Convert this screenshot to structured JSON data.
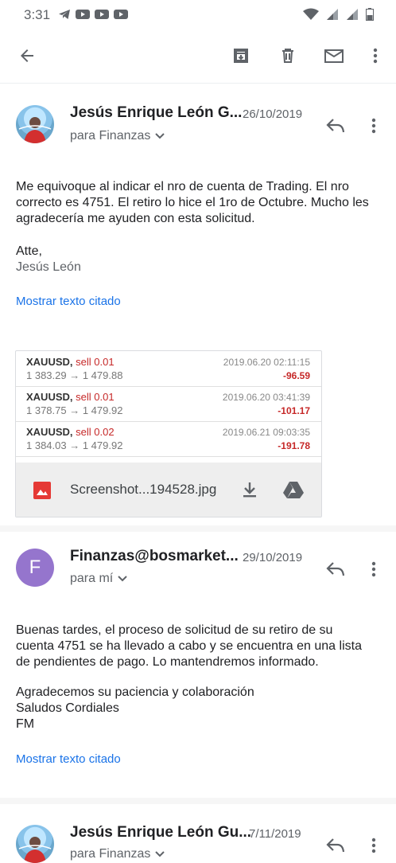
{
  "status_bar": {
    "time": "3:31"
  },
  "messages": [
    {
      "sender": "Jesús Enrique León G...",
      "date": "26/10/2019",
      "recipient": "para Finanzas",
      "body_lines": [
        "Me equivoque al indicar el nro de cuenta de Trading. El nro",
        "correcto es 4751. El retiro lo hice el 1ro de Octubre. Mucho les",
        "agradecería me ayuden con esta solicitud."
      ],
      "signoff": "Atte,",
      "signature": "Jesús León",
      "quoted_link": "Mostrar texto citado"
    },
    {
      "avatar_letter": "F",
      "avatar_color": "#9575cd",
      "sender": "Finanzas@bosmarket...",
      "date": "29/10/2019",
      "recipient": "para mí",
      "body_lines": [
        "Buenas tardes, el proceso de solicitud de su retiro de su",
        "cuenta 4751 se ha llevado a cabo y se encuentra en una lista",
        "de pendientes de pago. Lo mantendremos informado."
      ],
      "closing_lines": [
        "Agradecemos su paciencia y colaboración",
        "Saludos Cordiales",
        "FM"
      ],
      "quoted_link": "Mostrar texto citado"
    },
    {
      "sender": "Jesús Enrique León Gu...",
      "date": "7/11/2019",
      "recipient": "para Finanzas"
    }
  ],
  "attachment": {
    "filename": "Screenshot...194528.jpg",
    "trades": [
      {
        "symbol": "XAUUSD,",
        "side": "sell 0.01",
        "prices": "1 383.29 → 1 479.88",
        "time": "2019.06.20 02:11:15",
        "pl": "-96.59"
      },
      {
        "symbol": "XAUUSD,",
        "side": "sell 0.01",
        "prices": "1 378.75 → 1 479.92",
        "time": "2019.06.20 03:41:39",
        "pl": "-101.17"
      },
      {
        "symbol": "XAUUSD,",
        "side": "sell 0.02",
        "prices": "1 384.03 → 1 479.92",
        "time": "2019.06.21 09:03:35",
        "pl": "-191.78"
      }
    ]
  },
  "colors": {
    "link": "#1a73e8",
    "loss": "#c62828",
    "icon": "#5f6368"
  },
  "icons": [
    "back-arrow-icon",
    "archive-icon",
    "trash-icon",
    "mail-icon",
    "more-vert-icon",
    "reply-icon",
    "chevron-down-icon",
    "image-icon",
    "download-icon",
    "drive-icon"
  ]
}
